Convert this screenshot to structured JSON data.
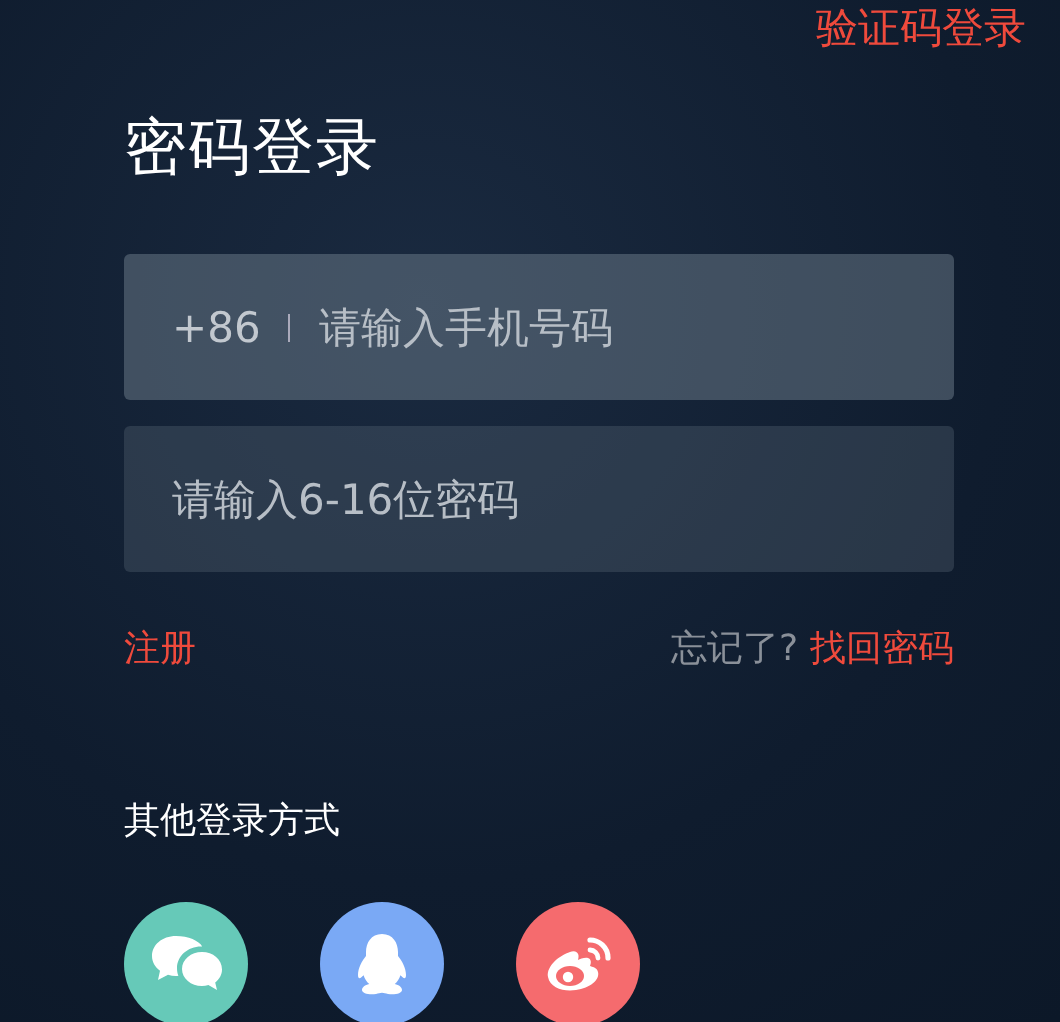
{
  "switch_mode_link": "验证码登录",
  "title": "密码登录",
  "phone_field": {
    "country_code": "+86",
    "placeholder": "请输入手机号码"
  },
  "password_field": {
    "placeholder": "请输入6-16位密码"
  },
  "register_link": "注册",
  "forgot_prompt": "忘记了?",
  "recover_link": "找回密码",
  "other_login": {
    "label": "其他登录方式",
    "methods": [
      {
        "kind": "wechat",
        "color": "#66c9b8"
      },
      {
        "kind": "qq",
        "color": "#7aa9f5"
      },
      {
        "kind": "weibo",
        "color": "#f56b6e"
      }
    ]
  }
}
